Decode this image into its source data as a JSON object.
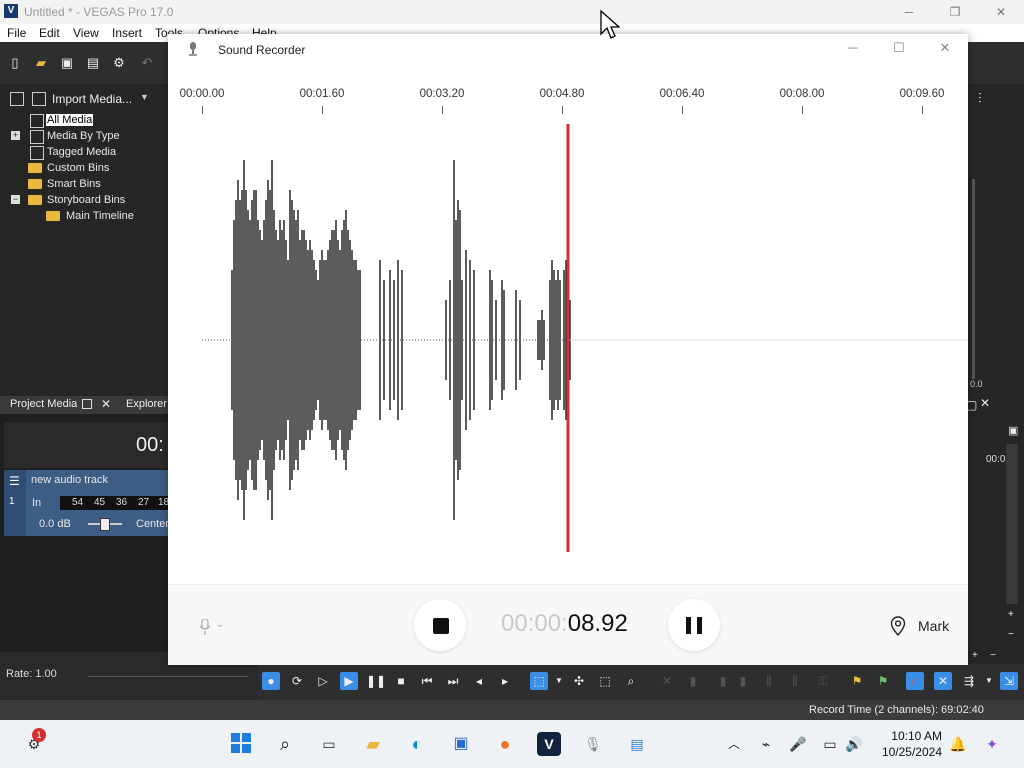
{
  "vegas": {
    "title": "Untitled * - VEGAS Pro 17.0",
    "logo": "V",
    "menu": [
      "File",
      "Edit",
      "View",
      "Insert",
      "Tools",
      "Options",
      "Help"
    ],
    "import_media": "Import Media...",
    "tree": [
      {
        "label": "All Media",
        "type": "media"
      },
      {
        "label": "Media By Type",
        "type": "media"
      },
      {
        "label": "Tagged Media",
        "type": "media"
      },
      {
        "label": "Custom Bins",
        "type": "folder"
      },
      {
        "label": "Smart Bins",
        "type": "folder"
      },
      {
        "label": "Storyboard Bins",
        "type": "folder"
      },
      {
        "label": "Main Timeline",
        "type": "folder"
      }
    ],
    "tabs": {
      "project_media": "Project Media",
      "explorer": "Explorer"
    },
    "timecode_partial": "00:",
    "track": {
      "name": "new audio track",
      "input": "In",
      "meter": [
        "54",
        "45",
        "36",
        "27",
        "18"
      ],
      "volume": "0.0 dB",
      "pan": "Center",
      "number": "1"
    },
    "rate": "Rate: 1.00",
    "record_time": "Record Time (2 channels): 69:02:40",
    "right_readout": "0.0",
    "right_time": "00:0"
  },
  "recorder": {
    "title": "Sound Recorder",
    "ticks": [
      "00:00.00",
      "00:01.60",
      "00:03.20",
      "00:04.80",
      "00:06.40",
      "00:08.00",
      "00:09.60"
    ],
    "timer_dim": "00:00:",
    "timer_main": "08.92",
    "mark_label": "Mark"
  },
  "taskbar": {
    "time": "10:10 AM",
    "date": "10/25/2024",
    "badge": "1"
  },
  "colors": {
    "playhead": "#d32f2f",
    "accent": "#3a8ee6"
  }
}
